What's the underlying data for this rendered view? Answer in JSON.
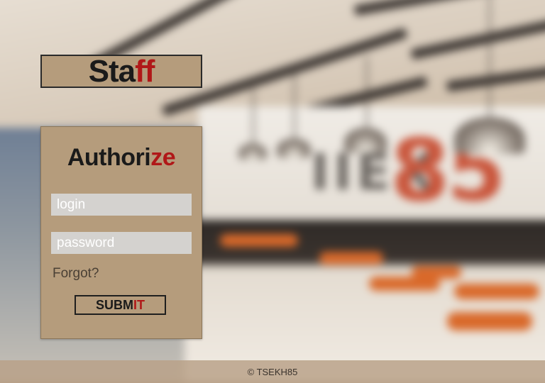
{
  "staff": {
    "part1": "Sta",
    "part2": "ff"
  },
  "authorize": {
    "part1": "Authori",
    "part2": "ze"
  },
  "form": {
    "login_placeholder": "login",
    "password_placeholder": "password",
    "forgot_label": "Forgot?",
    "submit_part1": "SUBM",
    "submit_part2": "IT"
  },
  "background": {
    "sign_text_left": "IIEX",
    "sign_text_right": "85"
  },
  "footer": {
    "copyright": "© TSEKH85"
  },
  "colors": {
    "panel": "#b59c7c",
    "accent_red": "#b01818",
    "dark": "#1a1a1a"
  }
}
